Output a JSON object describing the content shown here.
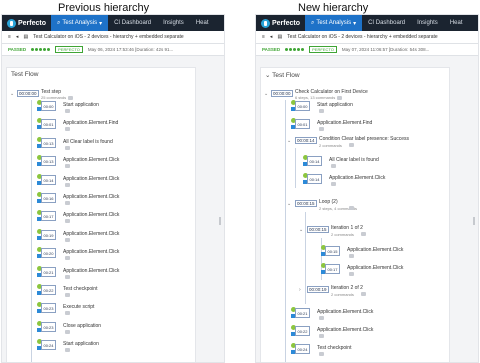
{
  "headings": {
    "left": "Previous hierarchy",
    "right": "New hierarchy"
  },
  "navbar": {
    "brand": "Perfecto",
    "active_tab": "Test Analysis",
    "items": [
      "CI Dashboard",
      "Insights",
      "Heat"
    ]
  },
  "left": {
    "subbar_title": "Test Calculator on iOS - 2 devices - hierarchy + embedded separate",
    "status": "PASSED",
    "perfecto_badge": "PERFECTO",
    "date": "May 06, 2024 17:53:46 [Duration: 42s 91...",
    "section_title": "Test Flow",
    "root": {
      "time": "00:00:00",
      "label": "Test step",
      "sub": "25 commands"
    },
    "steps": [
      {
        "time": "00:00",
        "label": "Start application"
      },
      {
        "time": "00:01",
        "label": "Application.Element.Find"
      },
      {
        "time": "00:13",
        "label": "All Clear label is found"
      },
      {
        "time": "00:13",
        "label": "Application.Element.Click"
      },
      {
        "time": "00:14",
        "label": "Application.Element.Click"
      },
      {
        "time": "00:16",
        "label": "Application.Element.Click"
      },
      {
        "time": "00:17",
        "label": "Application.Element.Click"
      },
      {
        "time": "00:19",
        "label": "Application.Element.Click"
      },
      {
        "time": "00:20",
        "label": "Application.Element.Click"
      },
      {
        "time": "00:21",
        "label": "Application.Element.Click"
      },
      {
        "time": "00:22",
        "label": "Test checkpoint"
      },
      {
        "time": "00:23",
        "label": "Execute script"
      },
      {
        "time": "00:23",
        "label": "Close application"
      },
      {
        "time": "00:24",
        "label": "Start application"
      }
    ]
  },
  "right": {
    "subbar_title": "Test Calculator on iOS - 2 devices - hierarchy + embedded separate",
    "status": "PASSED",
    "perfecto_badge": "PERFECTO",
    "date": "May 07, 2024 11:06:57 [Duration: 54s 308...",
    "section_title": "Test Flow",
    "root": {
      "time": "00:00:00",
      "label": "Check Calculator on First Device",
      "sub": "6 steps, 13 commands"
    },
    "items": [
      {
        "time": "00:00",
        "label": "Start application"
      },
      {
        "time": "00:01",
        "label": "Application.Element.Find"
      },
      {
        "time": "00:00:14",
        "label": "Condition Clear label presence: Success",
        "sub": "2 commands"
      },
      {
        "time": "00:14",
        "label": "All Clear label is found"
      },
      {
        "time": "00:14",
        "label": "Application.Element.Click"
      },
      {
        "time": "00:00:15",
        "label": "Loop (2)",
        "sub": "2 steps, 4 commands"
      },
      {
        "time": "00:00:15",
        "label": "Iteration 1 of 2",
        "sub": "2 commands"
      },
      {
        "time": "00:15",
        "label": "Application.Element.Click"
      },
      {
        "time": "00:17",
        "label": "Application.Element.Click"
      },
      {
        "time": "00:00:19",
        "label": "Iteration 2 of 2",
        "sub": "2 commands"
      },
      {
        "time": "00:21",
        "label": "Application.Element.Click"
      },
      {
        "time": "00:22",
        "label": "Application.Element.Click"
      },
      {
        "time": "00:24",
        "label": "Test checkpoint"
      }
    ]
  },
  "colors": {
    "nav_bg": "#1b2430",
    "nav_active": "#1e72c8",
    "passed": "#3fa535",
    "step_green": "#8cc63f",
    "step_blue": "#2c8ad8"
  }
}
